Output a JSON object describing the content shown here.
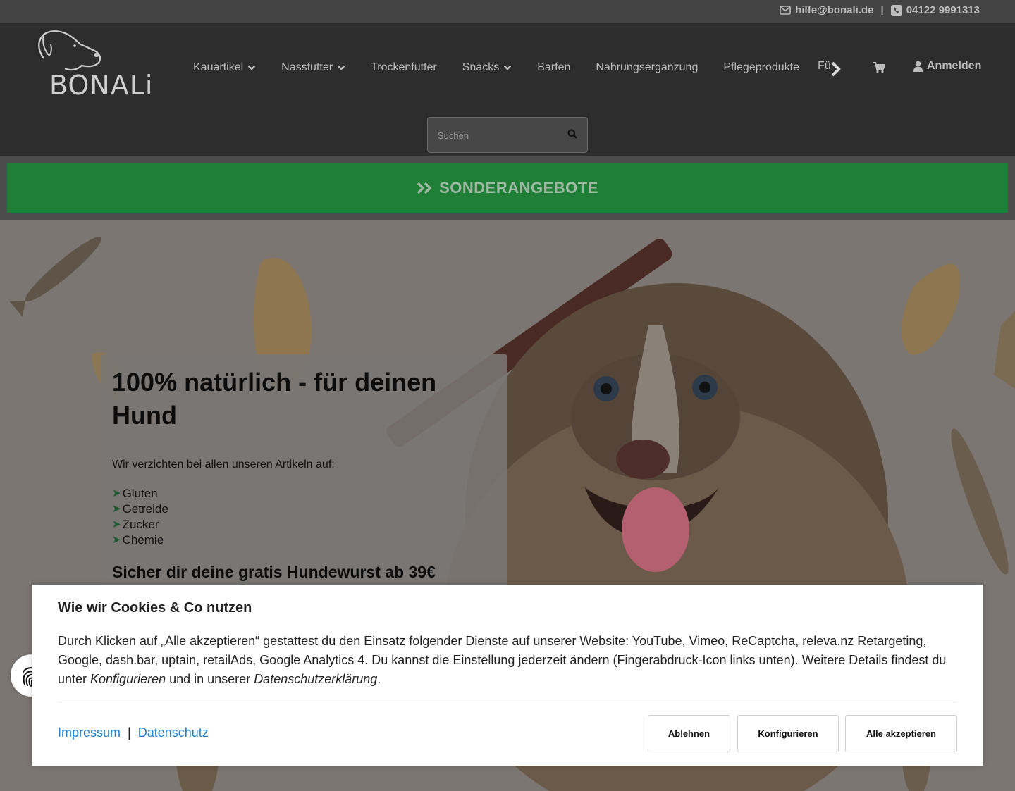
{
  "topbar": {
    "email": "hilfe@bonali.de",
    "separator": "|",
    "phone": "04122 9991313",
    "icons": [
      "envelope-icon",
      "phone-icon"
    ]
  },
  "header": {
    "logo_text": "BONALi",
    "nav": [
      {
        "label": "Kauartikel",
        "has_dropdown": true
      },
      {
        "label": "Nassfutter",
        "has_dropdown": true
      },
      {
        "label": "Trockenfutter",
        "has_dropdown": false
      },
      {
        "label": "Snacks",
        "has_dropdown": true
      },
      {
        "label": "Barfen",
        "has_dropdown": false
      },
      {
        "label": "Nahrungsergänzung",
        "has_dropdown": false
      },
      {
        "label": "Pflegeprodukte",
        "has_dropdown": false
      }
    ],
    "nav_clipped": "Fü",
    "login_label": "Anmelden",
    "search_placeholder": "Suchen"
  },
  "specials": {
    "label": "SONDERANGEBOTE"
  },
  "hero": {
    "title": "100% natürlich - für deinen Hund",
    "intro": "Wir verzichten bei allen unseren Artikeln auf:",
    "list": [
      "Gluten",
      "Getreide",
      "Zucker",
      "Chemie"
    ],
    "list_marker": "➤",
    "subtitle": "Sicher dir deine gratis Hundewurst ab 39€"
  },
  "cookie": {
    "title": "Wie wir Cookies & Co nutzen",
    "text_part1": "Durch Klicken auf „Alle akzeptieren“ gestattest du den Einsatz folgender Dienste auf unserer Website: YouTube, Vimeo, ReCaptcha, releva.nz Retargeting, Google, dash.bar, uptain, retailAds, Google Analytics 4. Du kannst die Einstellung jederzeit ändern (Fingerabdruck-Icon links unten). Weitere Details findest du unter ",
    "text_link1": "Konfigurieren",
    "text_part2": " und in unserer ",
    "text_link2": "Datenschutzerklärung",
    "text_part3": ".",
    "link_impressum": "Impressum",
    "link_sep": "|",
    "link_datenschutz": "Datenschutz",
    "btn_decline": "Ablehnen",
    "btn_configure": "Konfigurieren",
    "btn_accept_all": "Alle akzeptieren"
  },
  "colors": {
    "topbar_bg": "#444444",
    "header_bg": "#2d2d2d",
    "specials_green": "#1f7f36",
    "link_blue": "#1f80d0"
  }
}
